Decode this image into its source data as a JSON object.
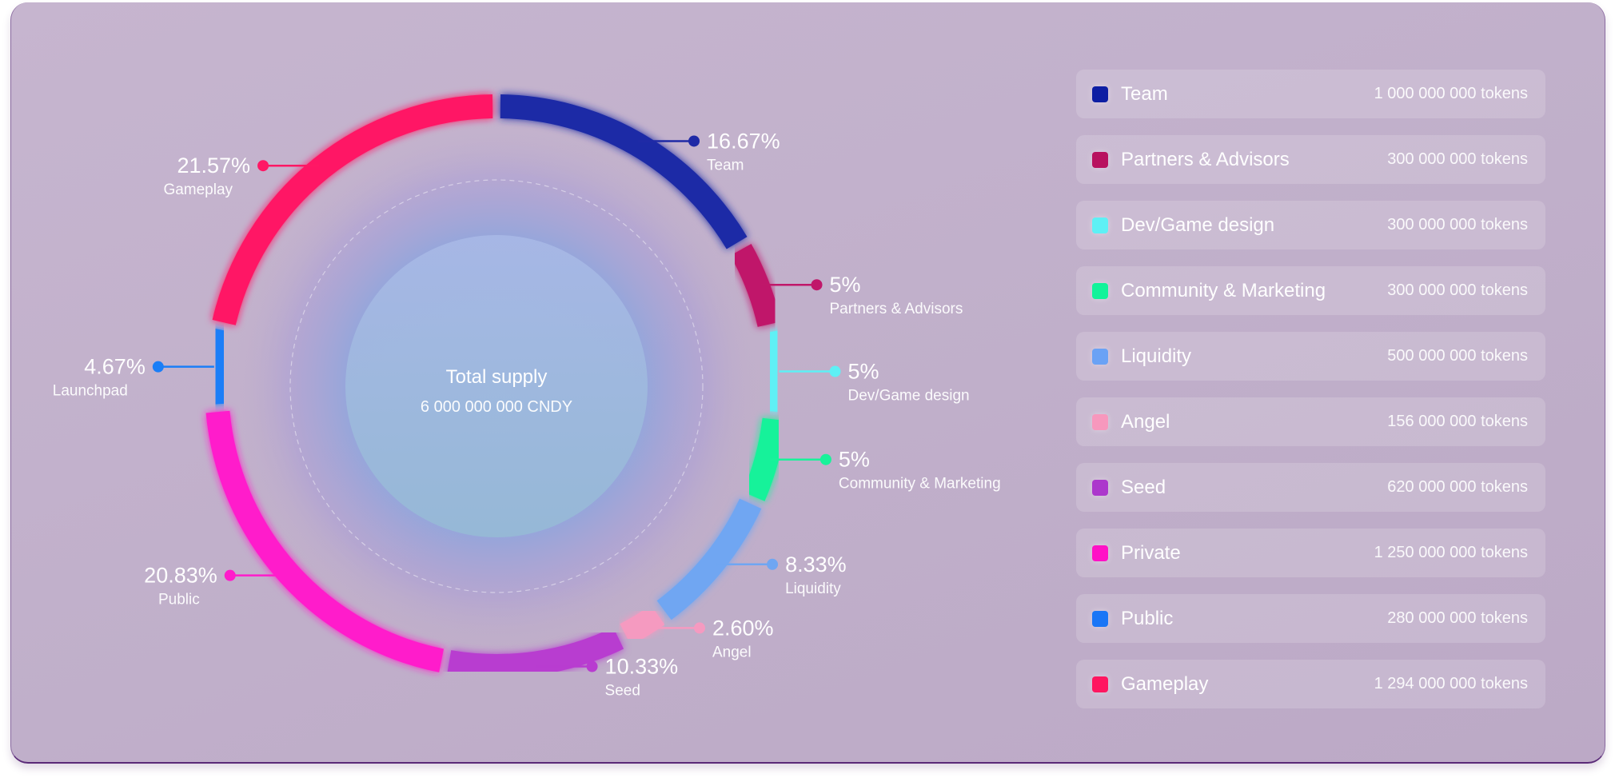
{
  "chart_data": {
    "type": "donut",
    "center": {
      "title": "Total supply",
      "subtitle": "6 000 000 000 CNDY"
    },
    "segments": [
      {
        "name": "Team",
        "percent": 16.67,
        "label": "16.67%",
        "color": "#1f2aa6",
        "side": "right"
      },
      {
        "name": "Partners & Advisors",
        "percent": 5,
        "label": "5%",
        "color": "#c0176a",
        "side": "right"
      },
      {
        "name": "Dev/Game design",
        "percent": 5,
        "label": "5%",
        "color": "#5ef0f5",
        "side": "right"
      },
      {
        "name": "Community & Marketing",
        "percent": 5,
        "label": "5%",
        "color": "#19f29a",
        "side": "right"
      },
      {
        "name": "Liquidity",
        "percent": 8.33,
        "label": "8.33%",
        "color": "#6fa6f2",
        "side": "right"
      },
      {
        "name": "Angel",
        "percent": 2.6,
        "label": "2.60%",
        "color": "#f59ac0",
        "side": "right"
      },
      {
        "name": "Seed",
        "percent": 10.33,
        "label": "10.33%",
        "color": "#b83cd0",
        "side": "right"
      },
      {
        "name": "Public",
        "percent": 20.83,
        "label": "20.83%",
        "color": "#ff1ccb",
        "side": "left"
      },
      {
        "name": "Launchpad",
        "percent": 4.67,
        "label": "4.67%",
        "color": "#1a7ef7",
        "side": "left"
      },
      {
        "name": "Gameplay",
        "percent": 21.57,
        "label": "21.57%",
        "color": "#ff1865",
        "side": "left"
      }
    ]
  },
  "legend": [
    {
      "name": "Team",
      "value": "1 000 000 000 tokens",
      "color": "#0d1ea3"
    },
    {
      "name": "Partners & Advisors",
      "value": "300 000 000 tokens",
      "color": "#b8125f"
    },
    {
      "name": "Dev/Game design",
      "value": "300 000 000 tokens",
      "color": "#5ef0f5"
    },
    {
      "name": "Community & Marketing",
      "value": "300 000 000 tokens",
      "color": "#12f39a"
    },
    {
      "name": "Liquidity",
      "value": "500 000 000 tokens",
      "color": "#6aa2f5"
    },
    {
      "name": "Angel",
      "value": "156 000 000 tokens",
      "color": "#f798bd"
    },
    {
      "name": "Seed",
      "value": "620 000 000 tokens",
      "color": "#ac38cc"
    },
    {
      "name": "Private",
      "value": "1 250 000 000 tokens",
      "color": "#ff12c6"
    },
    {
      "name": "Public",
      "value": "280 000 000 tokens",
      "color": "#1a76f6"
    },
    {
      "name": "Gameplay",
      "value": "1 294 000 000 tokens",
      "color": "#ff1660"
    }
  ]
}
